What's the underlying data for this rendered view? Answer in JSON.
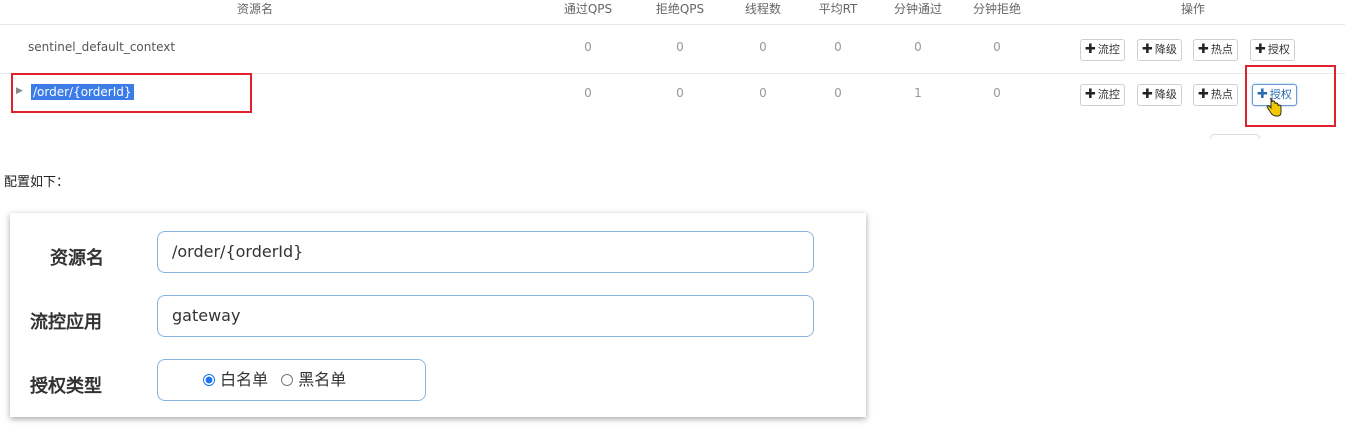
{
  "table": {
    "headers": [
      "资源名",
      "通过QPS",
      "拒绝QPS",
      "线程数",
      "平均RT",
      "分钟通过",
      "分钟拒绝",
      "操作"
    ],
    "rows": [
      {
        "name": "sentinel_default_context",
        "values": [
          "0",
          "0",
          "0",
          "0",
          "0",
          "0"
        ]
      },
      {
        "name": "/order/{orderId}",
        "values": [
          "0",
          "0",
          "0",
          "0",
          "1",
          "0"
        ],
        "expand_icon": "▶"
      }
    ],
    "actions": [
      "流控",
      "降级",
      "热点",
      "授权"
    ],
    "plus": "✚"
  },
  "caption": "配置如下：",
  "form": {
    "resource_label": "资源名",
    "resource_value": "/order/{orderId}",
    "app_label": "流控应用",
    "app_value": "gateway",
    "auth_label": "授权类型",
    "auth_options": [
      "白名单",
      "黑名单"
    ],
    "auth_selected": "白名单"
  }
}
